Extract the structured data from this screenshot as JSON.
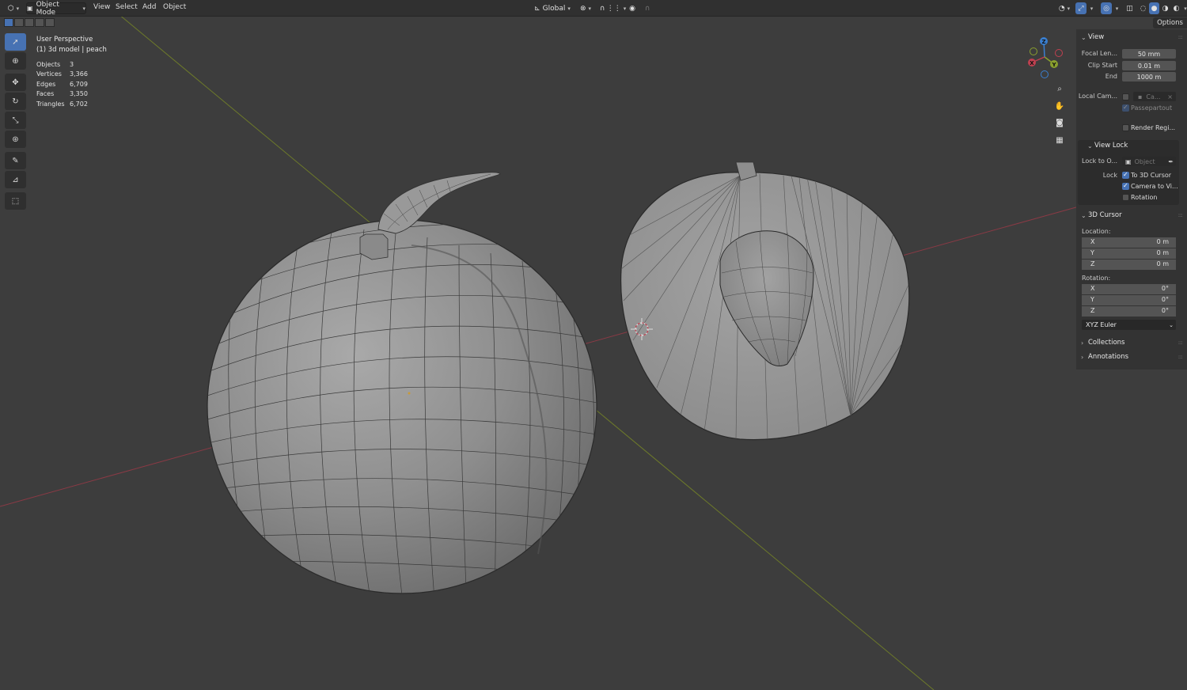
{
  "header": {
    "mode_label": "Object Mode",
    "menus": [
      "View",
      "Select",
      "Add",
      "Object"
    ],
    "orientation_label": "Global"
  },
  "options_label": "Options",
  "overlay": {
    "view_name": "User Perspective",
    "object_name": "(1) 3d model | peach"
  },
  "stats": [
    {
      "label": "Objects",
      "value": "3"
    },
    {
      "label": "Vertices",
      "value": "3,366"
    },
    {
      "label": "Edges",
      "value": "6,709"
    },
    {
      "label": "Faces",
      "value": "3,350"
    },
    {
      "label": "Triangles",
      "value": "6,702"
    }
  ],
  "gizmo": {
    "x": "X",
    "y": "Y",
    "z": "Z"
  },
  "panel": {
    "view": {
      "title": "View",
      "focal_label": "Focal Len...",
      "focal_value": "50 mm",
      "clip_start_label": "Clip Start",
      "clip_start_value": "0.01 m",
      "end_label": "End",
      "end_value": "1000 m",
      "local_cam_label": "Local Cam...",
      "local_cam_value": "Ca...",
      "passepartout_label": "Passepartout",
      "render_region_label": "Render Regi..."
    },
    "view_lock": {
      "title": "View Lock",
      "lock_to_label": "Lock to O...",
      "lock_to_placeholder": "Object",
      "lock_label": "Lock",
      "to_3d_cursor": "To 3D Cursor",
      "camera_to_view": "Camera to Vi...",
      "rotation": "Rotation"
    },
    "cursor": {
      "title": "3D Cursor",
      "location_label": "Location:",
      "location": [
        {
          "axis": "X",
          "value": "0 m"
        },
        {
          "axis": "Y",
          "value": "0 m"
        },
        {
          "axis": "Z",
          "value": "0 m"
        }
      ],
      "rotation_label": "Rotation:",
      "rotation": [
        {
          "axis": "X",
          "value": "0°"
        },
        {
          "axis": "Y",
          "value": "0°"
        },
        {
          "axis": "Z",
          "value": "0°"
        }
      ],
      "rotation_mode": "XYZ Euler"
    },
    "collections_title": "Collections",
    "annotations_title": "Annotations"
  },
  "colors": {
    "accent": "#4772b3",
    "viewport_bg": "#3d3d3d",
    "axis_x": "#c04050",
    "axis_y": "#8aa02e",
    "axis_z": "#3a7fd0"
  }
}
